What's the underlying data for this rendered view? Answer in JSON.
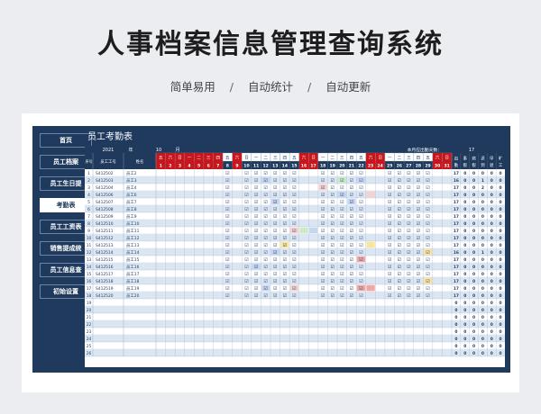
{
  "hero": {
    "title": "人事档案信息管理查询系统",
    "features": [
      "简单易用",
      "自动统计",
      "自动更新"
    ],
    "separator": "/"
  },
  "sidebar": {
    "active_index": 3,
    "items": [
      {
        "label": "首页"
      },
      {
        "label": "员工档案"
      },
      {
        "label": "员工生日提"
      },
      {
        "label": "考勤表"
      },
      {
        "label": "员工工资表"
      },
      {
        "label": "销售提成统"
      },
      {
        "label": "员工信息查"
      },
      {
        "label": "初始设置"
      }
    ]
  },
  "sheet": {
    "title": "员工考勤表",
    "year": "2021",
    "year_unit": "年",
    "month": "10",
    "month_unit": "月",
    "required_days_label": "本月应出勤天数：",
    "required_days": "17",
    "headers": {
      "seq": "序号",
      "id": "员工工号",
      "name": "姓名"
    },
    "summary_headers": [
      "出勤",
      "事假",
      "病假",
      "迟到",
      "早退",
      "旷工"
    ],
    "weekdays": [
      "五",
      "六",
      "日",
      "一",
      "二",
      "三",
      "四",
      "五",
      "六",
      "日",
      "一",
      "二",
      "三",
      "四",
      "五",
      "六",
      "日",
      "一",
      "二",
      "三",
      "四",
      "五",
      "六",
      "日",
      "一",
      "二",
      "三",
      "四",
      "五",
      "六",
      "日"
    ],
    "days": [
      "1",
      "2",
      "3",
      "4",
      "5",
      "6",
      "7",
      "8",
      "9",
      "10",
      "11",
      "12",
      "13",
      "14",
      "15",
      "16",
      "17",
      "18",
      "19",
      "20",
      "21",
      "22",
      "23",
      "24",
      "25",
      "26",
      "27",
      "28",
      "29",
      "30",
      "31"
    ],
    "red_days": [
      1,
      2,
      3,
      4,
      5,
      6,
      7,
      9,
      16,
      17,
      23,
      24,
      30,
      31
    ],
    "rows": [
      {
        "seq": "1",
        "id": "S412502",
        "name": "员工2",
        "sum": [
          "17",
          "0",
          "0",
          "0",
          "0",
          "0"
        ]
      },
      {
        "seq": "2",
        "id": "S412503",
        "name": "员工3",
        "sum": [
          "16",
          "0",
          "0",
          "1",
          "0",
          "0"
        ]
      },
      {
        "seq": "3",
        "id": "S412504",
        "name": "员工4",
        "sum": [
          "17",
          "0",
          "0",
          "2",
          "0",
          "0"
        ]
      },
      {
        "seq": "4",
        "id": "S412506",
        "name": "员工6",
        "sum": [
          "17",
          "0",
          "0",
          "0",
          "0",
          "0"
        ]
      },
      {
        "seq": "5",
        "id": "S412507",
        "name": "员工7",
        "sum": [
          "17",
          "0",
          "0",
          "0",
          "0",
          "0"
        ]
      },
      {
        "seq": "6",
        "id": "S412508",
        "name": "员工8",
        "sum": [
          "17",
          "0",
          "0",
          "0",
          "0",
          "0"
        ]
      },
      {
        "seq": "7",
        "id": "S412509",
        "name": "员工9",
        "sum": [
          "17",
          "0",
          "0",
          "0",
          "0",
          "0"
        ]
      },
      {
        "seq": "8",
        "id": "S412510",
        "name": "员工10",
        "sum": [
          "17",
          "0",
          "0",
          "0",
          "0",
          "0"
        ]
      },
      {
        "seq": "9",
        "id": "S412511",
        "name": "员工11",
        "sum": [
          "17",
          "0",
          "0",
          "0",
          "0",
          "0"
        ]
      },
      {
        "seq": "10",
        "id": "S412512",
        "name": "员工12",
        "sum": [
          "17",
          "0",
          "0",
          "0",
          "0",
          "0"
        ]
      },
      {
        "seq": "11",
        "id": "S412513",
        "name": "员工13",
        "sum": [
          "17",
          "0",
          "0",
          "0",
          "0",
          "0"
        ]
      },
      {
        "seq": "12",
        "id": "S412514",
        "name": "员工14",
        "sum": [
          "16",
          "0",
          "0",
          "1",
          "0",
          "0"
        ]
      },
      {
        "seq": "13",
        "id": "S412515",
        "name": "员工15",
        "sum": [
          "17",
          "0",
          "0",
          "0",
          "0",
          "0"
        ]
      },
      {
        "seq": "14",
        "id": "S412516",
        "name": "员工16",
        "sum": [
          "17",
          "0",
          "0",
          "0",
          "0",
          "0"
        ]
      },
      {
        "seq": "15",
        "id": "S412517",
        "name": "员工17",
        "sum": [
          "17",
          "0",
          "0",
          "0",
          "0",
          "0"
        ]
      },
      {
        "seq": "16",
        "id": "S412518",
        "name": "员工18",
        "sum": [
          "17",
          "0",
          "0",
          "0",
          "0",
          "0"
        ]
      },
      {
        "seq": "17",
        "id": "S412519",
        "name": "员工19",
        "sum": [
          "17",
          "0",
          "0",
          "0",
          "0",
          "0"
        ]
      },
      {
        "seq": "18",
        "id": "S412520",
        "name": "员工20",
        "sum": [
          "17",
          "0",
          "0",
          "0",
          "0",
          "0"
        ]
      },
      {
        "seq": "19",
        "id": "",
        "name": "",
        "sum": [
          "0",
          "0",
          "0",
          "0",
          "0",
          "0"
        ]
      },
      {
        "seq": "20",
        "id": "",
        "name": "",
        "sum": [
          "0",
          "0",
          "0",
          "0",
          "0",
          "0"
        ]
      },
      {
        "seq": "21",
        "id": "",
        "name": "",
        "sum": [
          "0",
          "0",
          "0",
          "0",
          "0",
          "0"
        ]
      },
      {
        "seq": "22",
        "id": "",
        "name": "",
        "sum": [
          "0",
          "0",
          "0",
          "0",
          "0",
          "0"
        ]
      },
      {
        "seq": "23",
        "id": "",
        "name": "",
        "sum": [
          "0",
          "0",
          "0",
          "0",
          "0",
          "0"
        ]
      },
      {
        "seq": "24",
        "id": "",
        "name": "",
        "sum": [
          "0",
          "0",
          "0",
          "0",
          "0",
          "0"
        ]
      },
      {
        "seq": "25",
        "id": "",
        "name": "",
        "sum": [
          "0",
          "0",
          "0",
          "0",
          "0",
          "0"
        ]
      },
      {
        "seq": "26",
        "id": "",
        "name": "",
        "sum": [
          "0",
          "0",
          "0",
          "0",
          "0",
          "0"
        ]
      }
    ],
    "present_mark": "☑",
    "marks": [
      {
        "row": 1,
        "day": 12,
        "type": "leave"
      },
      {
        "row": 1,
        "day": 20,
        "type": "sick"
      },
      {
        "row": 1,
        "day": 22,
        "type": "leave"
      },
      {
        "row": 2,
        "day": 18,
        "type": "late"
      },
      {
        "row": 3,
        "day": 20,
        "type": "leave"
      },
      {
        "row": 3,
        "day": 23,
        "type": "late"
      },
      {
        "row": 4,
        "day": 13,
        "type": "leave"
      },
      {
        "row": 4,
        "day": 21,
        "type": "leave"
      },
      {
        "row": 8,
        "day": 15,
        "type": "late"
      },
      {
        "row": 8,
        "day": 16,
        "type": "sick"
      },
      {
        "row": 8,
        "day": 17,
        "type": "leave"
      },
      {
        "row": 10,
        "day": 14,
        "type": "absent"
      },
      {
        "row": 10,
        "day": 23,
        "type": "absent"
      },
      {
        "row": 11,
        "day": 13,
        "type": "leave"
      },
      {
        "row": 11,
        "day": 29,
        "type": "absent"
      },
      {
        "row": 12,
        "day": 22,
        "type": "early"
      },
      {
        "row": 13,
        "day": 11,
        "type": "leave"
      },
      {
        "row": 15,
        "day": 29,
        "type": "absent"
      },
      {
        "row": 16,
        "day": 12,
        "type": "leave"
      },
      {
        "row": 16,
        "day": 15,
        "type": "late"
      },
      {
        "row": 16,
        "day": 22,
        "type": "early"
      },
      {
        "row": 16,
        "day": 23,
        "type": "early"
      }
    ],
    "mark_colors": {
      "leave": "#c6d6f0",
      "sick": "#c9ecc4",
      "late": "#f7d0d0",
      "early": "#f4a6a6",
      "absent": "#fbe59a"
    },
    "colors": {
      "navy": "#1f3a5c",
      "red": "#c8161d",
      "rowalt": "#dce6f3",
      "grid": "#8ea4c2"
    }
  }
}
